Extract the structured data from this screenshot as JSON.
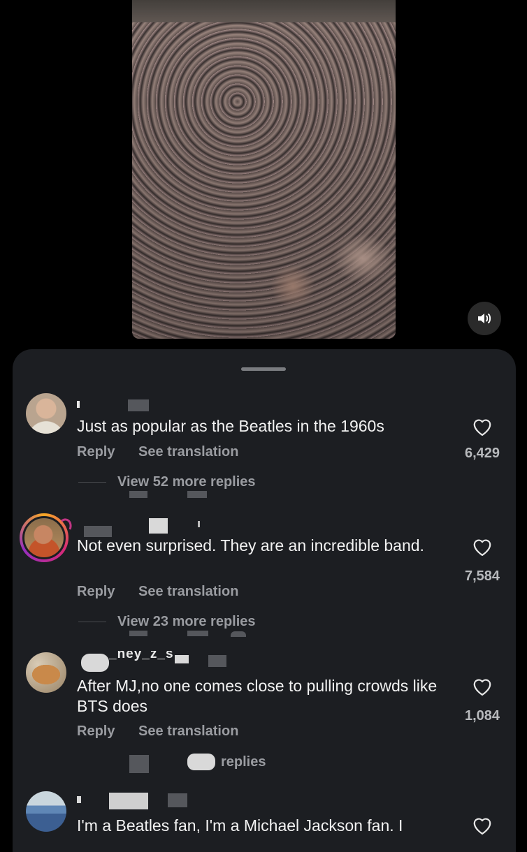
{
  "video": {
    "speaker_icon": "speaker-icon"
  },
  "comments": [
    {
      "text": "Just as popular as the Beatles in the 1960s",
      "reply": "Reply",
      "translate": "See translation",
      "likes": "6,429",
      "more_replies": "View 52 more replies"
    },
    {
      "text": "Not even surprised. They are an incredible band.",
      "reply": "Reply",
      "translate": "See translation",
      "likes": "7,584",
      "more_replies": "View 23 more replies"
    },
    {
      "username_partial": "_ney_z_s",
      "text": "After MJ,no one comes close to pulling crowds like BTS does",
      "reply": "Reply",
      "translate": "See translation",
      "likes": "1,084",
      "more_replies": "replies"
    },
    {
      "text": "I'm a Beatles fan, I'm a Michael Jackson fan. I"
    }
  ],
  "colors": {
    "sheet_bg": "#1c1e22",
    "text_primary": "#f2f2f2",
    "text_secondary": "#9a9ca1",
    "story_ring_start": "#f9a825",
    "story_ring_end": "#d62976"
  }
}
